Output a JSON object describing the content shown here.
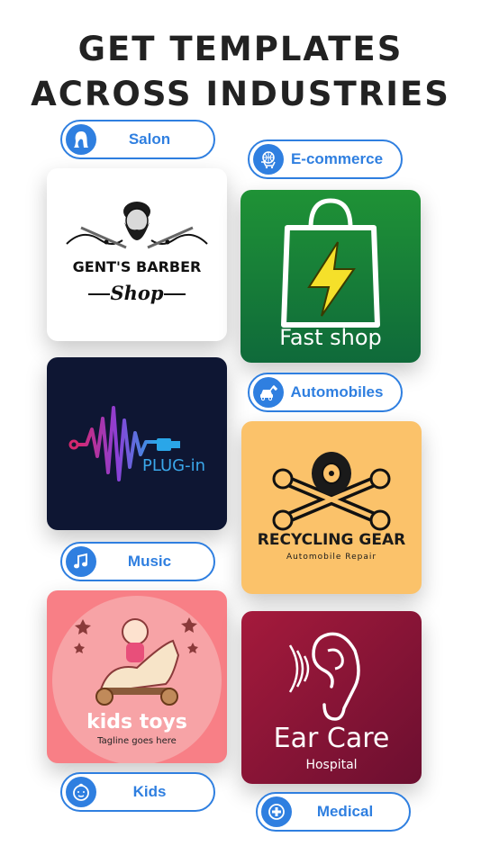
{
  "headline": {
    "line1": "GET TEMPLATES",
    "line2": "ACROSS INDUSTRIES"
  },
  "categories": {
    "salon": {
      "label": "Salon",
      "icon": "hair-icon"
    },
    "ecommerce": {
      "label": "E-commerce",
      "icon": "shopping-cart-icon"
    },
    "automobiles": {
      "label": "Automobiles",
      "icon": "car-repair-icon"
    },
    "music": {
      "label": "Music",
      "icon": "music-note-icon"
    },
    "kids": {
      "label": "Kids",
      "icon": "baby-face-icon"
    },
    "medical": {
      "label": "Medical",
      "icon": "medical-cross-icon"
    }
  },
  "templates": {
    "barber": {
      "title": "GENT'S BARBER",
      "subtitle": "Shop"
    },
    "fastshop": {
      "title": "Fast shop"
    },
    "plugin": {
      "title": "PLUG-in"
    },
    "recycling": {
      "title": "RECYCLING GEAR",
      "subtitle": "Automobile Repair"
    },
    "kidstoys": {
      "title": "kids toys",
      "tagline": "Tagline goes here"
    },
    "earcare": {
      "title": "Ear Care",
      "subtitle": "Hospital"
    }
  },
  "colors": {
    "accent": "#2f7fe0",
    "green_card": "#1f9236",
    "navy_card": "#0e1633",
    "amber_card": "#fbc26a",
    "pink_card": "#f87f86",
    "maroon_card": "#8e1538"
  }
}
